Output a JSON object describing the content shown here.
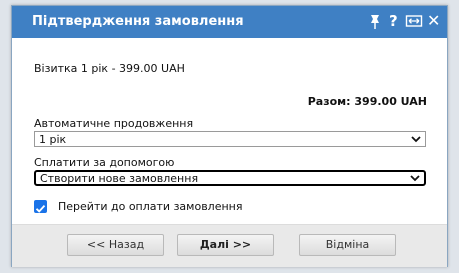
{
  "dialog": {
    "title": "Підтвердження замовлення",
    "icons": [
      "pin-icon",
      "help-icon",
      "resize-icon",
      "close-icon"
    ],
    "help_glyph": "?",
    "close_glyph": "✕"
  },
  "order": {
    "item_line": "Візитка 1 рік - 399.00 UAH",
    "total": "Разом: 399.00 UAH"
  },
  "renewal": {
    "label": "Автоматичне продовження",
    "value": "1 рік"
  },
  "payment": {
    "label": "Сплатити за допомогою",
    "value": "Створити нове замовлення"
  },
  "checkout": {
    "label": "Перейти до оплати замовлення",
    "checked": true
  },
  "buttons": {
    "back": "<< Назад",
    "next": "Далі >>",
    "cancel": "Відміна"
  },
  "colors": {
    "titlebar": "#3f80c4",
    "checkbox": "#1a73e8"
  }
}
